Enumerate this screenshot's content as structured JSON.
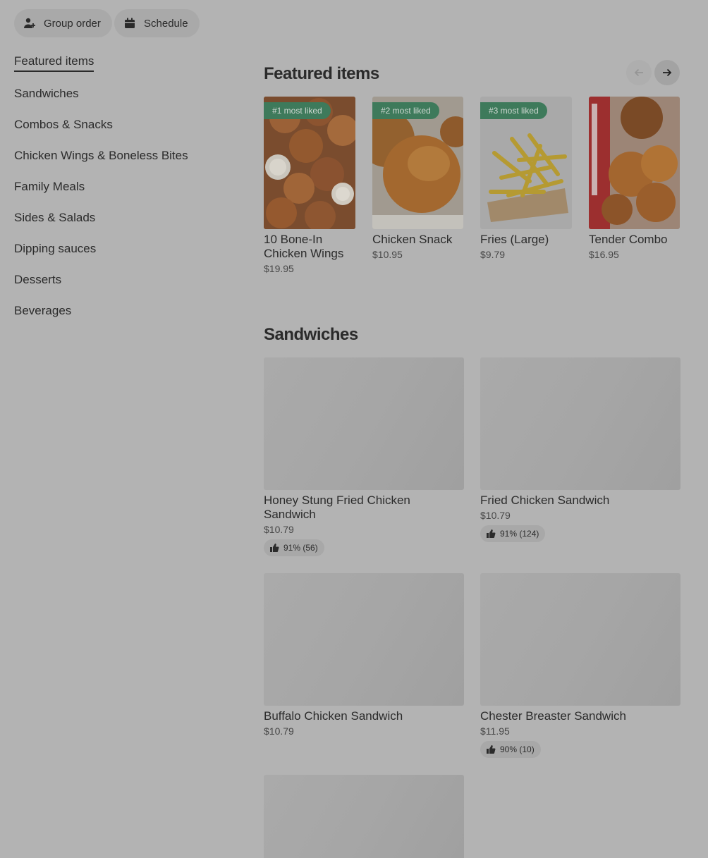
{
  "top_buttons": {
    "group_order": "Group order",
    "schedule": "Schedule"
  },
  "nav": {
    "items": [
      "Featured items",
      "Sandwiches",
      "Combos & Snacks",
      "Chicken Wings & Boneless Bites",
      "Family Meals",
      "Sides & Salads",
      "Dipping sauces",
      "Desserts",
      "Beverages"
    ],
    "active": "Featured items"
  },
  "featured": {
    "title": "Featured items",
    "items": [
      {
        "badge": "#1 most liked",
        "name": "10 Bone-In Chicken Wings",
        "price": "$19.95"
      },
      {
        "badge": "#2 most liked",
        "name": "Chicken Snack",
        "price": "$10.95"
      },
      {
        "badge": "#3 most liked",
        "name": "Fries (Large)",
        "price": "$9.79"
      },
      {
        "badge": "",
        "name": "Tender Combo",
        "price": "$16.95"
      }
    ]
  },
  "sandwiches": {
    "title": "Sandwiches",
    "items": [
      {
        "name": "Honey Stung Fried Chicken Sandwich",
        "price": "$10.79",
        "rating": "91% (56)"
      },
      {
        "name": "Fried Chicken Sandwich",
        "price": "$10.79",
        "rating": "91% (124)"
      },
      {
        "name": "Buffalo Chicken Sandwich",
        "price": "$10.79",
        "rating": ""
      },
      {
        "name": "Chester Breaster Sandwich",
        "price": "$11.95",
        "rating": "90% (10)"
      }
    ]
  },
  "colors": {
    "badge_green": "#3e7a5b",
    "overlay_gray": "#b3b3b3",
    "text": "#2b2b2b"
  },
  "icons": [
    "add-person-icon",
    "calendar-icon",
    "arrow-left-icon",
    "arrow-right-icon",
    "thumbs-up-icon"
  ]
}
